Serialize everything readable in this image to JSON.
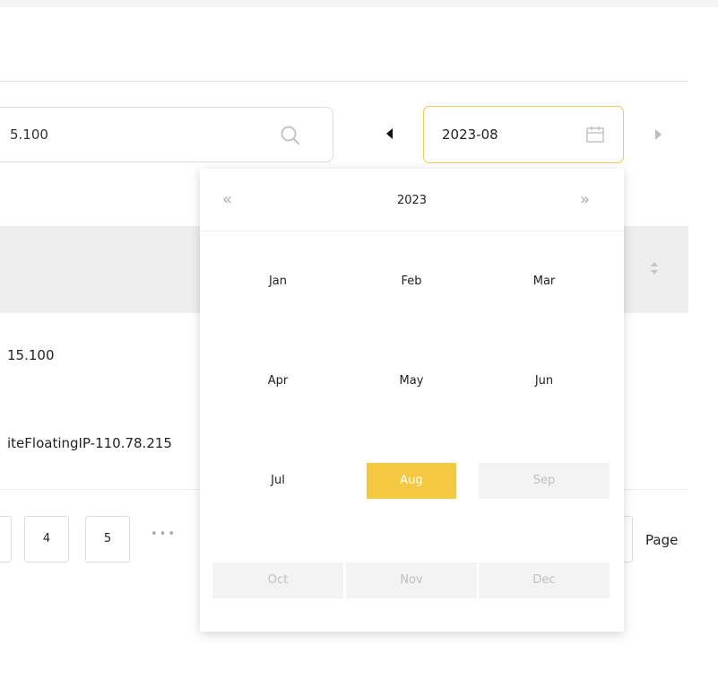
{
  "search": {
    "value": "5.100"
  },
  "date_input": {
    "value": "2023-08"
  },
  "table": {
    "rows": [
      {
        "text": "15.100"
      },
      {
        "text": "iteFloatingIP-110.78.215"
      }
    ]
  },
  "pagination": {
    "pages": [
      "4",
      "5"
    ],
    "ellipsis": "•••",
    "page_label": "Page"
  },
  "picker": {
    "prev_year": "«",
    "next_year": "»",
    "year": "2023",
    "months": [
      "Jan",
      "Feb",
      "Mar",
      "Apr",
      "May",
      "Jun",
      "Jul",
      "Aug",
      "Sep",
      "Oct",
      "Nov",
      "Dec"
    ],
    "selected": "Aug",
    "disabled": [
      "Sep",
      "Oct",
      "Nov",
      "Dec"
    ]
  },
  "colors": {
    "accent": "#f5c842",
    "focus_border": "#f2c94c",
    "disabled_bg": "#f3f3f3",
    "header_bg": "#eeeeef"
  }
}
